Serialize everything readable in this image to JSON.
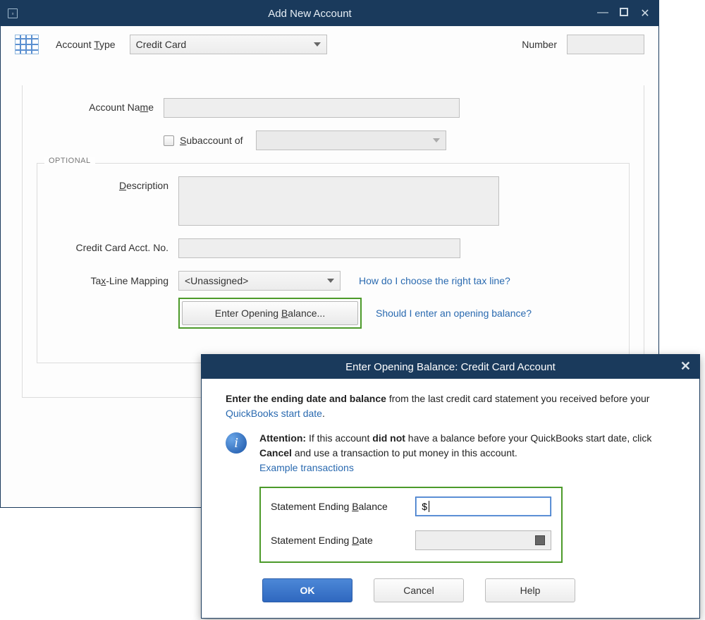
{
  "window": {
    "title": "Add New Account",
    "accountTypeLabel": "Account Type",
    "accountTypeValue": "Credit Card",
    "numberLabel": "Number",
    "numberValue": "",
    "accountNameLabel": "Account Name",
    "accountNameValue": "",
    "subaccountLabel": "Subaccount of",
    "subaccountValue": "",
    "optionalLegend": "OPTIONAL",
    "descriptionLabel": "Description",
    "descriptionValue": "",
    "ccAcctLabel": "Credit Card Acct. No.",
    "ccAcctValue": "",
    "taxLineLabel": "Tax-Line Mapping",
    "taxLineValue": "<Unassigned>",
    "taxLineHelpLink": "How do I choose the right tax line?",
    "openingBalanceButton": "Enter Opening Balance...",
    "openingBalanceHelpLink": "Should I enter an opening balance?"
  },
  "dialog": {
    "title": "Enter Opening Balance: Credit Card Account",
    "line1_a": "Enter the ending date and balance",
    "line1_b": " from the last credit card statement you received before your ",
    "startDateLink": "QuickBooks start date",
    "line1_c": ".",
    "attentionLabel": "Attention:",
    "line2_a": " If this account ",
    "line2_bold1": "did not",
    "line2_b": " have a balance before your QuickBooks start date, click ",
    "line2_bold2": "Cancel",
    "line2_c": " and use a transaction to put money in this account. ",
    "exampleLink": "Example transactions",
    "stmtBalanceLabel": "Statement Ending Balance",
    "stmtBalanceValue": "$",
    "stmtDateLabel": "Statement Ending Date",
    "stmtDateValue": "",
    "okLabel": "OK",
    "cancelLabel": "Cancel",
    "helpLabel": "Help"
  }
}
